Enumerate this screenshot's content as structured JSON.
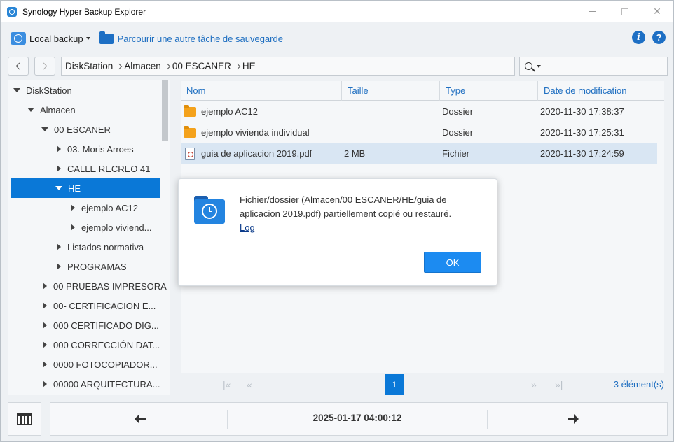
{
  "window": {
    "title": "Synology Hyper Backup Explorer"
  },
  "toolbar": {
    "local_backup_label": "Local backup",
    "browse_label": "Parcourir une autre tâche de sauvegarde",
    "info_glyph": "i",
    "help_glyph": "?"
  },
  "breadcrumb": [
    "DiskStation",
    "Almacen",
    "00 ESCANER",
    "HE"
  ],
  "search": {
    "value": ""
  },
  "tree": [
    {
      "label": "DiskStation",
      "level": 0,
      "expanded": true
    },
    {
      "label": "Almacen",
      "level": 1,
      "expanded": true
    },
    {
      "label": "00 ESCANER",
      "level": 2,
      "expanded": true
    },
    {
      "label": "03. Moris Arroes",
      "level": 3,
      "expanded": false
    },
    {
      "label": "CALLE RECREO 41",
      "level": 3,
      "expanded": false
    },
    {
      "label": "HE",
      "level": 3,
      "expanded": true,
      "selected": true
    },
    {
      "label": "ejemplo AC12",
      "level": 4,
      "expanded": false
    },
    {
      "label": "ejemplo viviend...",
      "level": 4,
      "expanded": false
    },
    {
      "label": "Listados normativa",
      "level": 3,
      "expanded": false
    },
    {
      "label": "PROGRAMAS",
      "level": 3,
      "expanded": false
    },
    {
      "label": "00 PRUEBAS IMPRESORA",
      "level": 2,
      "expanded": false
    },
    {
      "label": "00- CERTIFICACION E...",
      "level": 2,
      "expanded": false
    },
    {
      "label": "000 CERTIFICADO DIG...",
      "level": 2,
      "expanded": false
    },
    {
      "label": "000 CORRECCIÓN DAT...",
      "level": 2,
      "expanded": false
    },
    {
      "label": "0000 FOTOCOPIADOR...",
      "level": 2,
      "expanded": false
    },
    {
      "label": "00000 ARQUITECTURA...",
      "level": 2,
      "expanded": false
    }
  ],
  "columns": {
    "name": "Nom",
    "size": "Taille",
    "type": "Type",
    "modified": "Date de modification"
  },
  "files": [
    {
      "name": "ejemplo AC12",
      "size": "",
      "type": "Dossier",
      "modified": "2020-11-30 17:38:37",
      "icon": "folder-icon"
    },
    {
      "name": "ejemplo vivienda individual",
      "size": "",
      "type": "Dossier",
      "modified": "2020-11-30 17:25:31",
      "icon": "folder-icon"
    },
    {
      "name": "guia de aplicacion 2019.pdf",
      "size": "2 MB",
      "type": "Fichier",
      "modified": "2020-11-30 17:24:59",
      "icon": "pdf-icon",
      "selected": true
    }
  ],
  "pager": {
    "first": "|«",
    "prev": "«",
    "current_page": "1",
    "next": "»",
    "last": "»|",
    "count": "3 élément(s)"
  },
  "timeline": {
    "date": "2025-01-17 04:00:12"
  },
  "dialog": {
    "message": "Fichier/dossier (Almacen/00 ESCANER/HE/guia de aplicacion 2019.pdf) partiellement copié ou restauré.",
    "link": "Log",
    "ok_label": "OK"
  },
  "colors": {
    "accent": "#0a78d7",
    "link": "#1f6fc1",
    "folder": "#f4a21c",
    "selected_row": "#d9e6f3"
  }
}
